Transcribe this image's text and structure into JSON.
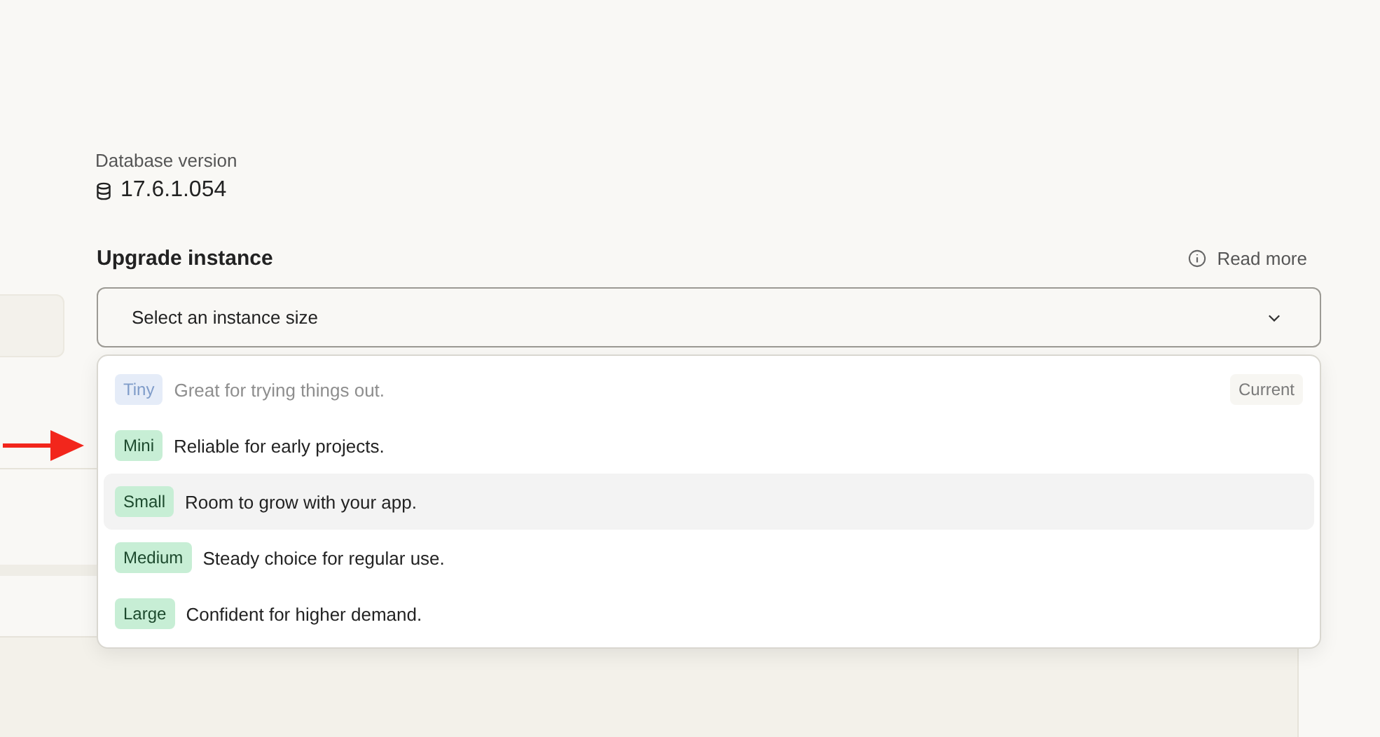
{
  "database_version": {
    "label": "Database version",
    "value": "17.6.1.054"
  },
  "upgrade": {
    "title": "Upgrade instance",
    "read_more": "Read more",
    "select": {
      "placeholder": "Select an instance size",
      "expanded": true
    },
    "options": [
      {
        "tag": "Tiny",
        "description": "Great for trying things out.",
        "disabled": true,
        "highlighted": false,
        "badge": "Current"
      },
      {
        "tag": "Mini",
        "description": "Reliable for early projects.",
        "disabled": false,
        "highlighted": false,
        "arrow_pointer": true
      },
      {
        "tag": "Small",
        "description": "Room to grow with your app.",
        "disabled": false,
        "highlighted": true
      },
      {
        "tag": "Medium",
        "description": "Steady choice for regular use.",
        "disabled": false,
        "highlighted": false
      },
      {
        "tag": "Large",
        "description": "Confident for higher demand.",
        "disabled": false,
        "highlighted": false
      }
    ]
  }
}
